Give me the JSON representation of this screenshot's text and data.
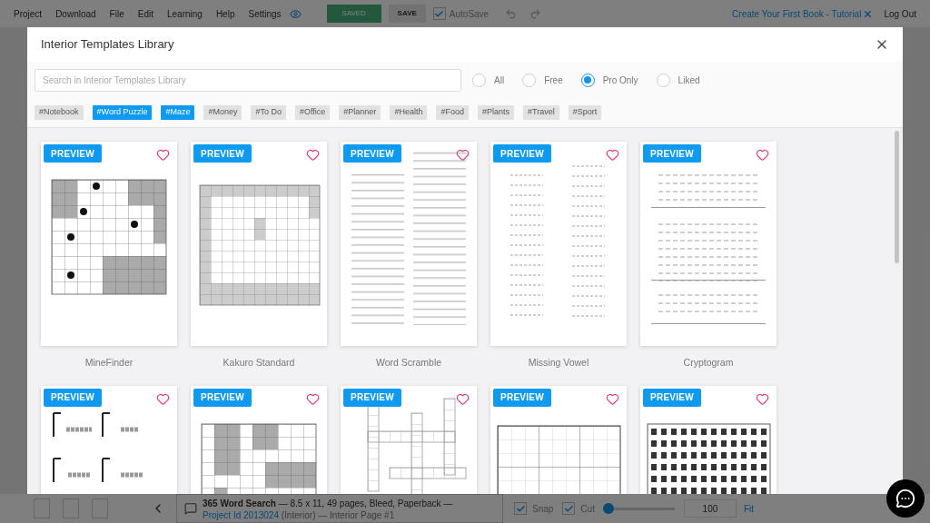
{
  "menu": {
    "items": [
      "Project",
      "Download",
      "File",
      "Edit",
      "Learning",
      "Help",
      "Settings"
    ],
    "saved_badge": "SAVED",
    "save_button": "SAVE",
    "autosave": {
      "label": "AutoSave",
      "checked": true
    },
    "tutorial_link": "Create Your First Book - Tutorial",
    "logout": "Log Out"
  },
  "modal": {
    "title": "Interior Templates Library",
    "search": {
      "placeholder": "Search in Interior Templates Library"
    },
    "filters": [
      {
        "label": "All",
        "selected": false
      },
      {
        "label": "Free",
        "selected": false
      },
      {
        "label": "Pro Only",
        "selected": true
      },
      {
        "label": "Liked",
        "selected": false
      }
    ],
    "tags": [
      {
        "label": "#Notebook",
        "selected": false
      },
      {
        "label": "#Word Puzzle",
        "selected": true
      },
      {
        "label": "#Maze",
        "selected": true
      },
      {
        "label": "#Money",
        "selected": false
      },
      {
        "label": "#To Do",
        "selected": false
      },
      {
        "label": "#Office",
        "selected": false
      },
      {
        "label": "#Planner",
        "selected": false
      },
      {
        "label": "#Health",
        "selected": false
      },
      {
        "label": "#Food",
        "selected": false
      },
      {
        "label": "#Plants",
        "selected": false
      },
      {
        "label": "#Travel",
        "selected": false
      },
      {
        "label": "#Sport",
        "selected": false
      }
    ],
    "templates": [
      {
        "preview": "PREVIEW",
        "name": "MineFinder",
        "liked": false,
        "kind": "mines"
      },
      {
        "preview": "PREVIEW",
        "name": "Kakuro Standard",
        "liked": false,
        "kind": "kakuro"
      },
      {
        "preview": "PREVIEW",
        "name": "Word Scramble",
        "liked": false,
        "kind": "wordlist"
      },
      {
        "preview": "PREVIEW",
        "name": "Missing Vowel",
        "liked": false,
        "kind": "vowels"
      },
      {
        "preview": "PREVIEW",
        "name": "Cryptogram",
        "liked": false,
        "kind": "cipher"
      },
      {
        "preview": "PREVIEW",
        "liked": false,
        "kind": "gallows"
      },
      {
        "preview": "PREVIEW",
        "liked": false,
        "kind": "blocks"
      },
      {
        "preview": "PREVIEW",
        "liked": false,
        "kind": "crossword"
      },
      {
        "preview": "PREVIEW",
        "liked": false,
        "kind": "sudoku"
      },
      {
        "preview": "PREVIEW",
        "liked": false,
        "kind": "letters"
      }
    ]
  },
  "status_bar": {
    "project_title": "365 Word Search",
    "details": "— 8.5 x 11, 49 pages, Bleed, Paperback —",
    "project_id_link": "Project Id 2013024",
    "page_info": "(Interior) — Interior Page #1",
    "snap": {
      "label": "Snap",
      "checked": true
    },
    "cut": {
      "label": "Cut",
      "checked": true
    },
    "zoom": {
      "level": 0.03,
      "value": "100"
    },
    "fit": "Fit"
  }
}
